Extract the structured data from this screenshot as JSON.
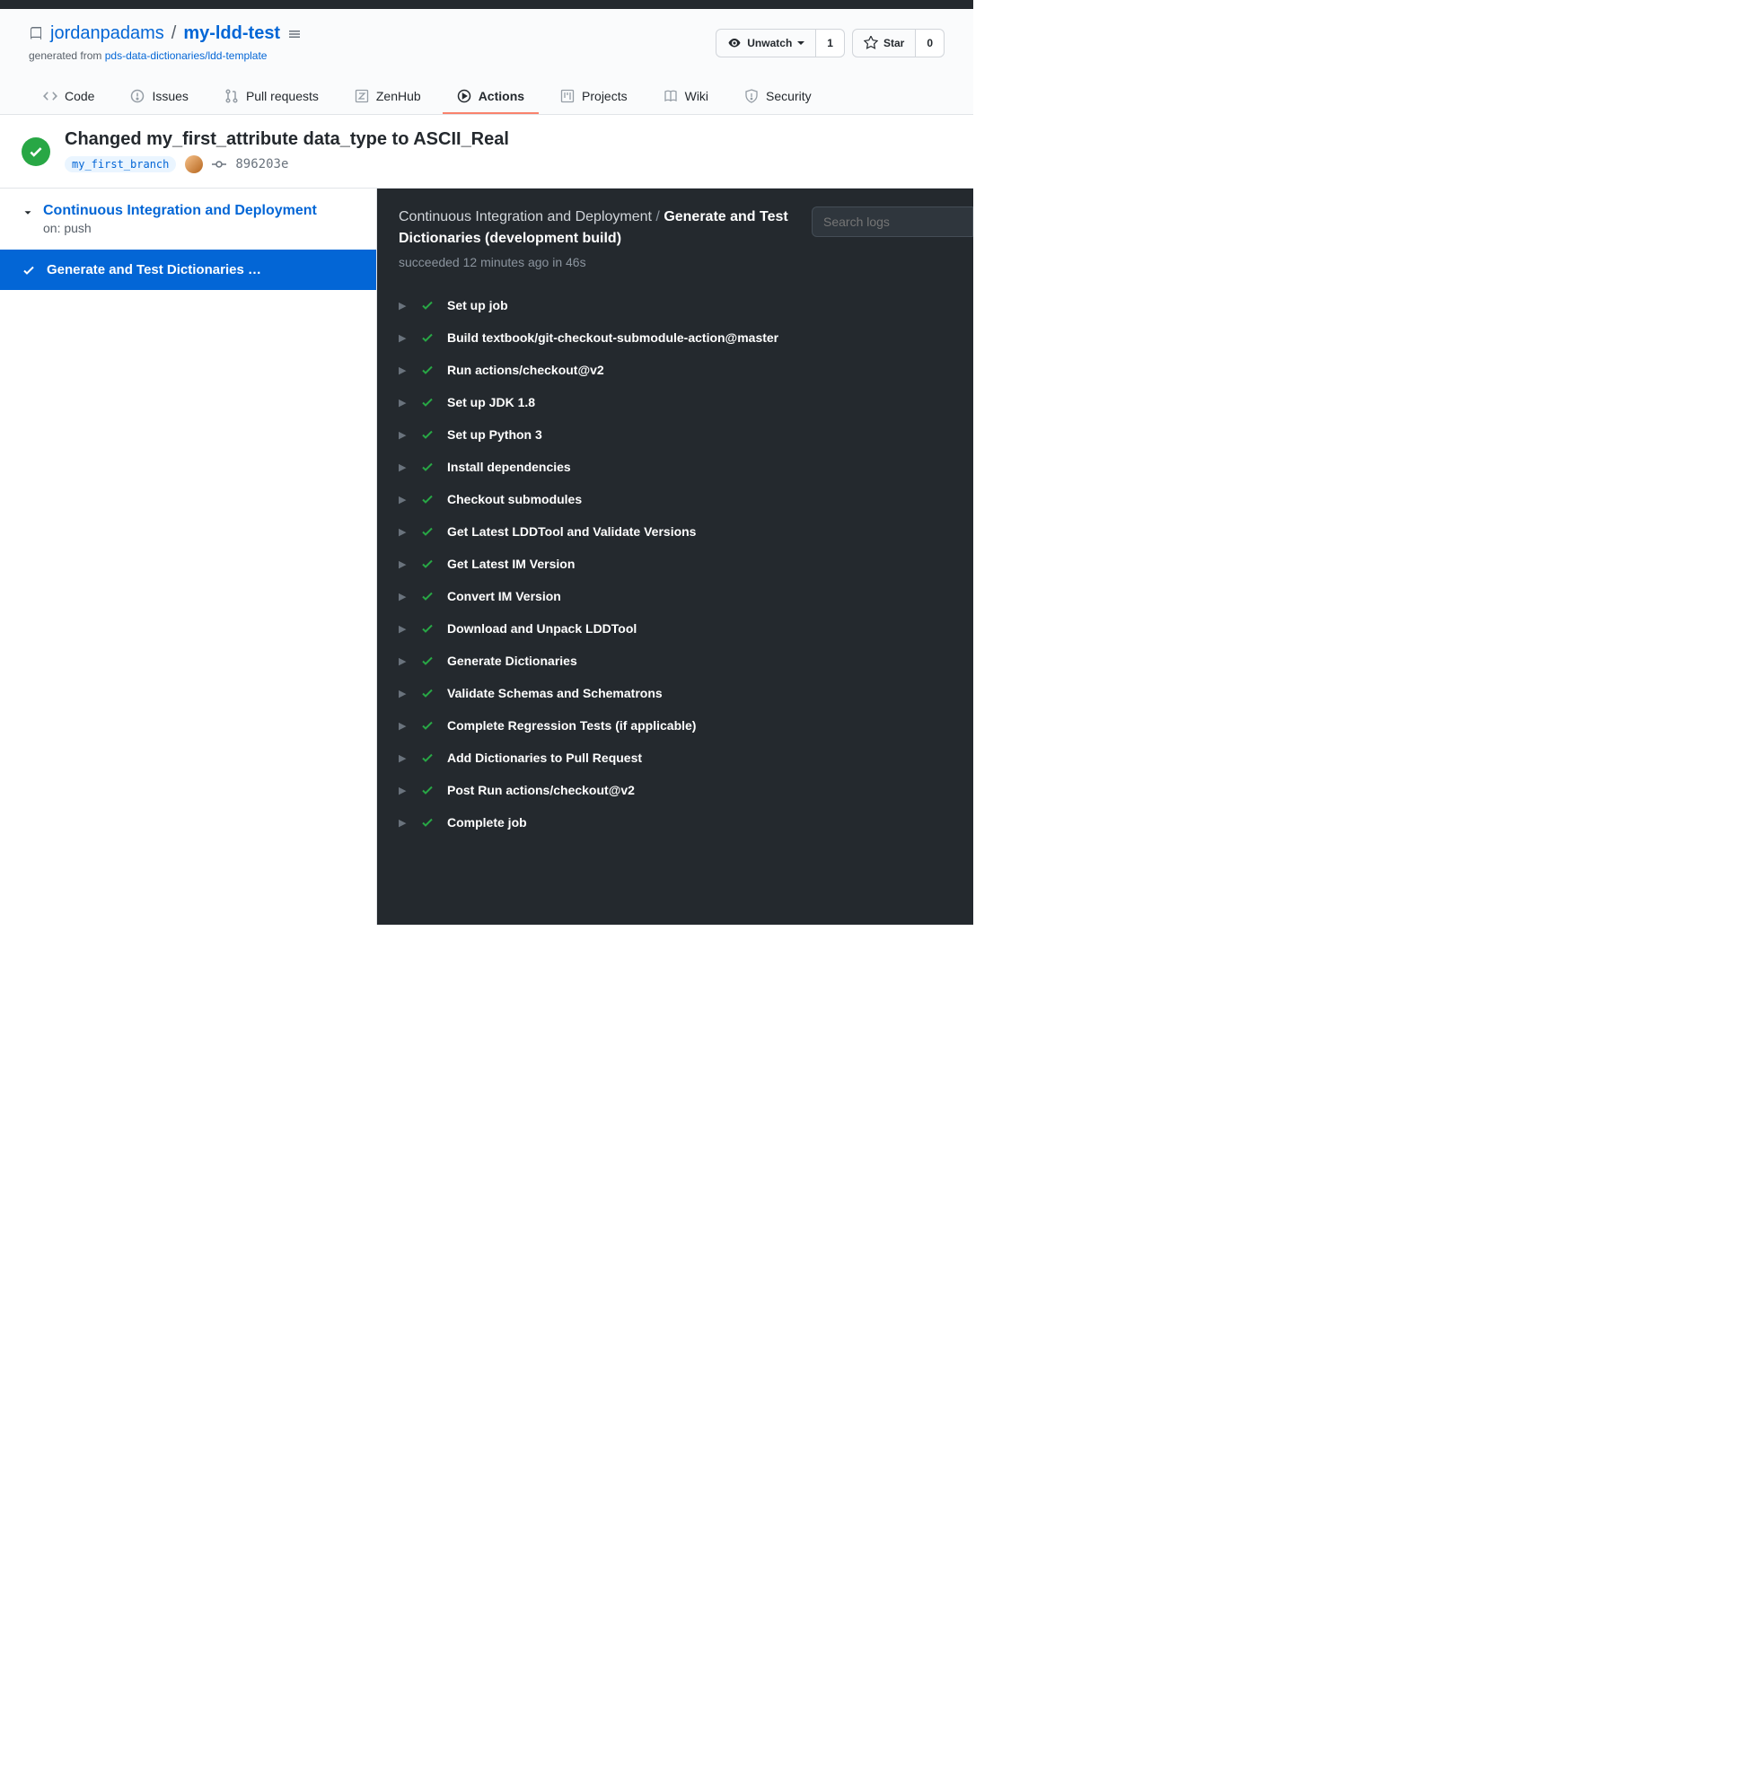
{
  "repo": {
    "owner": "jordanpadams",
    "name": "my-ldd-test",
    "generated_prefix": "generated from ",
    "generated_link": "pds-data-dictionaries/ldd-template"
  },
  "actions": {
    "unwatch": {
      "label": "Unwatch",
      "count": "1"
    },
    "star": {
      "label": "Star",
      "count": "0"
    }
  },
  "tabs": {
    "code": "Code",
    "issues": "Issues",
    "pulls": "Pull requests",
    "zenhub": "ZenHub",
    "actions": "Actions",
    "projects": "Projects",
    "wiki": "Wiki",
    "security": "Security"
  },
  "run": {
    "title": "Changed my_first_attribute data_type to ASCII_Real",
    "branch": "my_first_branch",
    "sha": "896203e"
  },
  "workflow": {
    "name": "Continuous Integration and Deployment",
    "on": "on: push",
    "job": "Generate and Test Dictionaries …"
  },
  "logs": {
    "breadcrumb_wf": "Continuous Integration and Deployment",
    "sep": " / ",
    "breadcrumb_job": "Generate and Test Dictionaries (development build)",
    "status_line": "succeeded 12 minutes ago in 46s",
    "search_placeholder": "Search logs"
  },
  "steps": [
    "Set up job",
    "Build textbook/git-checkout-submodule-action@master",
    "Run actions/checkout@v2",
    "Set up JDK 1.8",
    "Set up Python 3",
    "Install dependencies",
    "Checkout submodules",
    "Get Latest LDDTool and Validate Versions",
    "Get Latest IM Version",
    "Convert IM Version",
    "Download and Unpack LDDTool",
    "Generate Dictionaries",
    "Validate Schemas and Schematrons",
    "Complete Regression Tests (if applicable)",
    "Add Dictionaries to Pull Request",
    "Post Run actions/checkout@v2",
    "Complete job"
  ]
}
